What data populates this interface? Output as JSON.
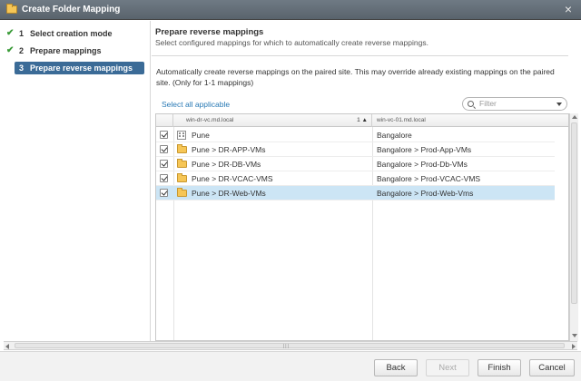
{
  "window": {
    "title": "Create Folder Mapping",
    "close_glyph": "×"
  },
  "steps": [
    {
      "num": "1",
      "label": "Select creation mode",
      "done": true,
      "active": false
    },
    {
      "num": "2",
      "label": "Prepare mappings",
      "done": true,
      "active": false
    },
    {
      "num": "3",
      "label": "Prepare reverse mappings",
      "done": false,
      "active": true
    }
  ],
  "step_check_glyph": "✔",
  "header": {
    "title": "Prepare reverse mappings",
    "subtitle": "Select configured mappings for which to automatically create reverse mappings."
  },
  "description": "Automatically create reverse mappings on the paired site. This may override already existing mappings on the paired site. (Only for 1-1 mappings)",
  "select_all_label": "Select all applicable",
  "filter": {
    "placeholder": "Filter"
  },
  "table": {
    "col_source": "win-dr-vc.md.local",
    "col_source_sort": "1 ▲",
    "col_target": "win-vc-01.md.local",
    "rows": [
      {
        "source": "Pune",
        "target": "Bangalore",
        "icon": "building-icon",
        "checked": true,
        "selected": false
      },
      {
        "source": "Pune > DR-APP-VMs",
        "target": "Bangalore > Prod-App-VMs",
        "icon": "folder-icon",
        "checked": true,
        "selected": false
      },
      {
        "source": "Pune > DR-DB-VMs",
        "target": "Bangalore > Prod-Db-VMs",
        "icon": "folder-icon",
        "checked": true,
        "selected": false
      },
      {
        "source": "Pune > DR-VCAC-VMS",
        "target": "Bangalore > Prod-VCAC-VMS",
        "icon": "folder-icon",
        "checked": true,
        "selected": false
      },
      {
        "source": "Pune > DR-Web-VMs",
        "target": "Bangalore > Prod-Web-Vms",
        "icon": "folder-icon",
        "checked": true,
        "selected": true
      }
    ]
  },
  "footer": {
    "back": "Back",
    "next": "Next",
    "finish": "Finish",
    "cancel": "Cancel"
  },
  "colors": {
    "accent": "#3b6b97",
    "link": "#2a7ab5",
    "selected_row": "#cce5f5",
    "check_green": "#3a9b38"
  }
}
